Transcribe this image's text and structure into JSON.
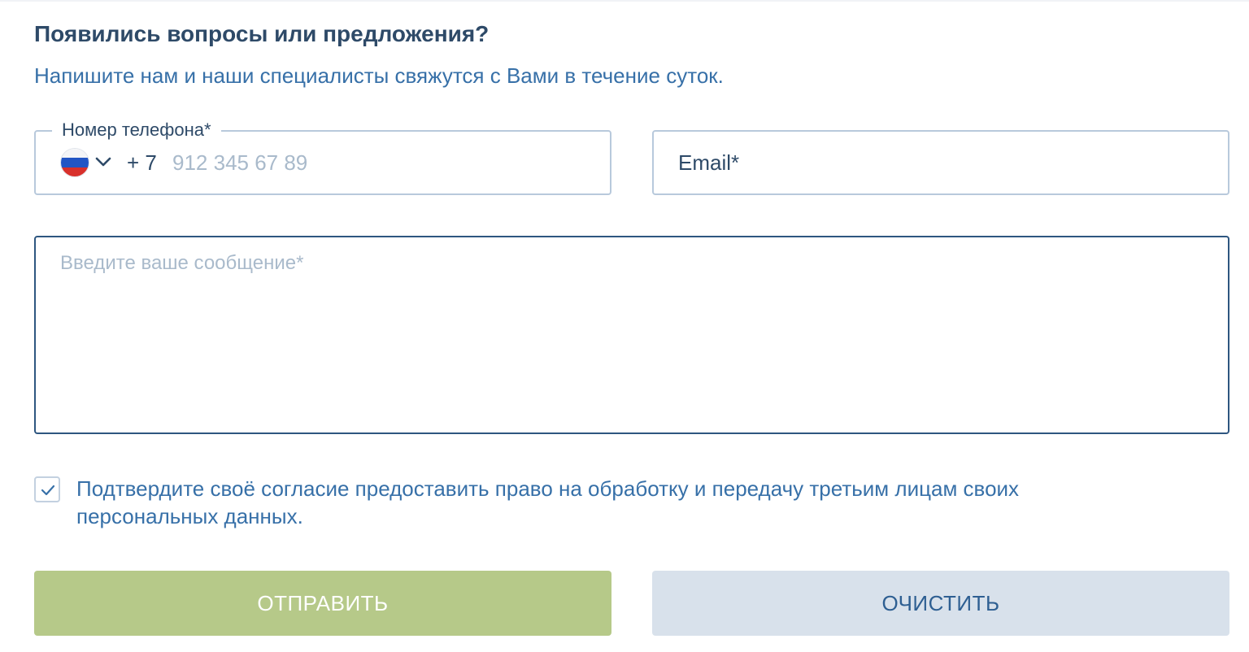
{
  "form": {
    "title": "Появились вопросы или предложения?",
    "subtitle": "Напишите нам и наши специалисты свяжутся с Вами в течение суток.",
    "phone": {
      "label": "Номер телефона*",
      "country_flag": "russia-flag-icon",
      "dial_code": "+ 7",
      "value": "",
      "placeholder": "912 345 67 89"
    },
    "email": {
      "value": "",
      "placeholder": "Email*"
    },
    "message": {
      "value": "",
      "placeholder": "Введите ваше сообщение*"
    },
    "consent": {
      "checked": true,
      "text": "Подтвердите своё согласие предоставить право на обработку и передачу третьим лицам своих персональных данных."
    },
    "buttons": {
      "submit_label": "ОТПРАВИТЬ",
      "clear_label": "ОЧИСТИТЬ"
    }
  },
  "colors": {
    "heading": "#2e4a68",
    "accent_text": "#3770a8",
    "field_border": "#b8c9dc",
    "active_field_border": "#2e5680",
    "submit_background": "#b6c989",
    "clear_background": "#d8e1eb"
  }
}
